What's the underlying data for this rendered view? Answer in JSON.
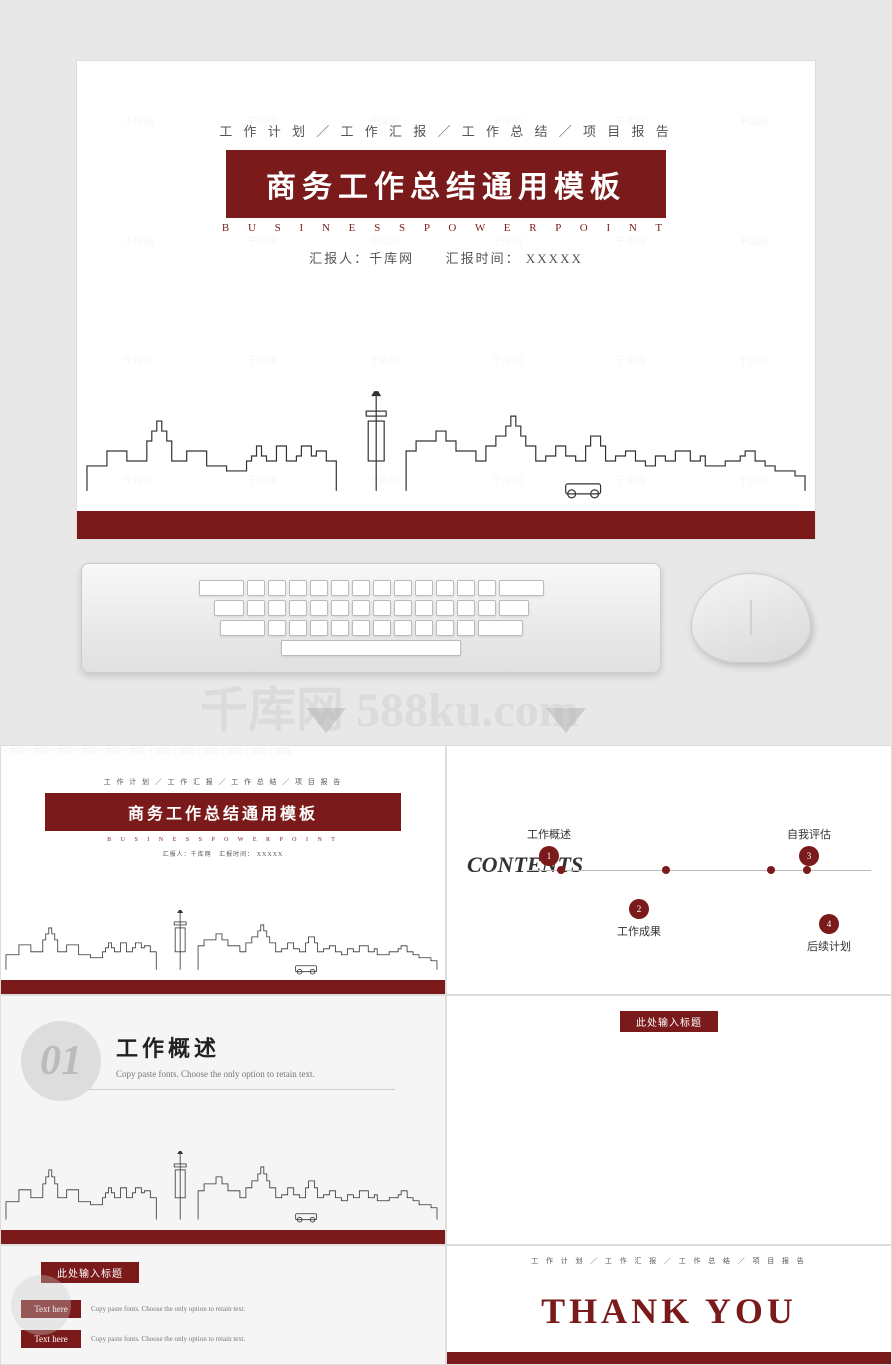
{
  "page": {
    "bg_color": "#e8e8e8"
  },
  "top_slide": {
    "subtitle": "工 作 计 划 ／ 工 作 汇 报 ／ 工 作 总 结 ／ 项 目 报 告",
    "main_title": "商务工作总结通用模板",
    "business_sub": "B U S I N E S S   P O W E R P O I N T",
    "reporter_label": "汇报人：千库网",
    "time_label": "汇报时间：",
    "time_value": "XXXXX"
  },
  "contents_slide": {
    "title": "CONTENTS",
    "item1_label": "工作概述",
    "item1_num": "1",
    "item2_label": "工作成果",
    "item2_num": "2",
    "item3_label": "自我评估",
    "item3_num": "3",
    "item4_label": "后续计划",
    "item4_num": "4"
  },
  "section01": {
    "num": "01",
    "title": "工作概述",
    "desc": "Copy paste fonts. Choose the only option to retain text."
  },
  "title_input": {
    "badge_text": "此处输入标题"
  },
  "texthere_slide": {
    "badge_text": "此处输入标题",
    "row1_label": "Text here",
    "row1_desc": "Copy paste fonts. Choose the only option to retain text.",
    "row2_label": "Text here",
    "row2_desc": "Copy paste fonts. Choose the only option to retain text."
  },
  "thankyou_slide": {
    "subtitle": "工 作 计 划 ／ 工 作 汇 报 ／ 工 作 总 结 ／ 项 目 报 告",
    "main_text": "THANK YOU"
  },
  "watermark": {
    "text": "千库网  588ku.com"
  }
}
